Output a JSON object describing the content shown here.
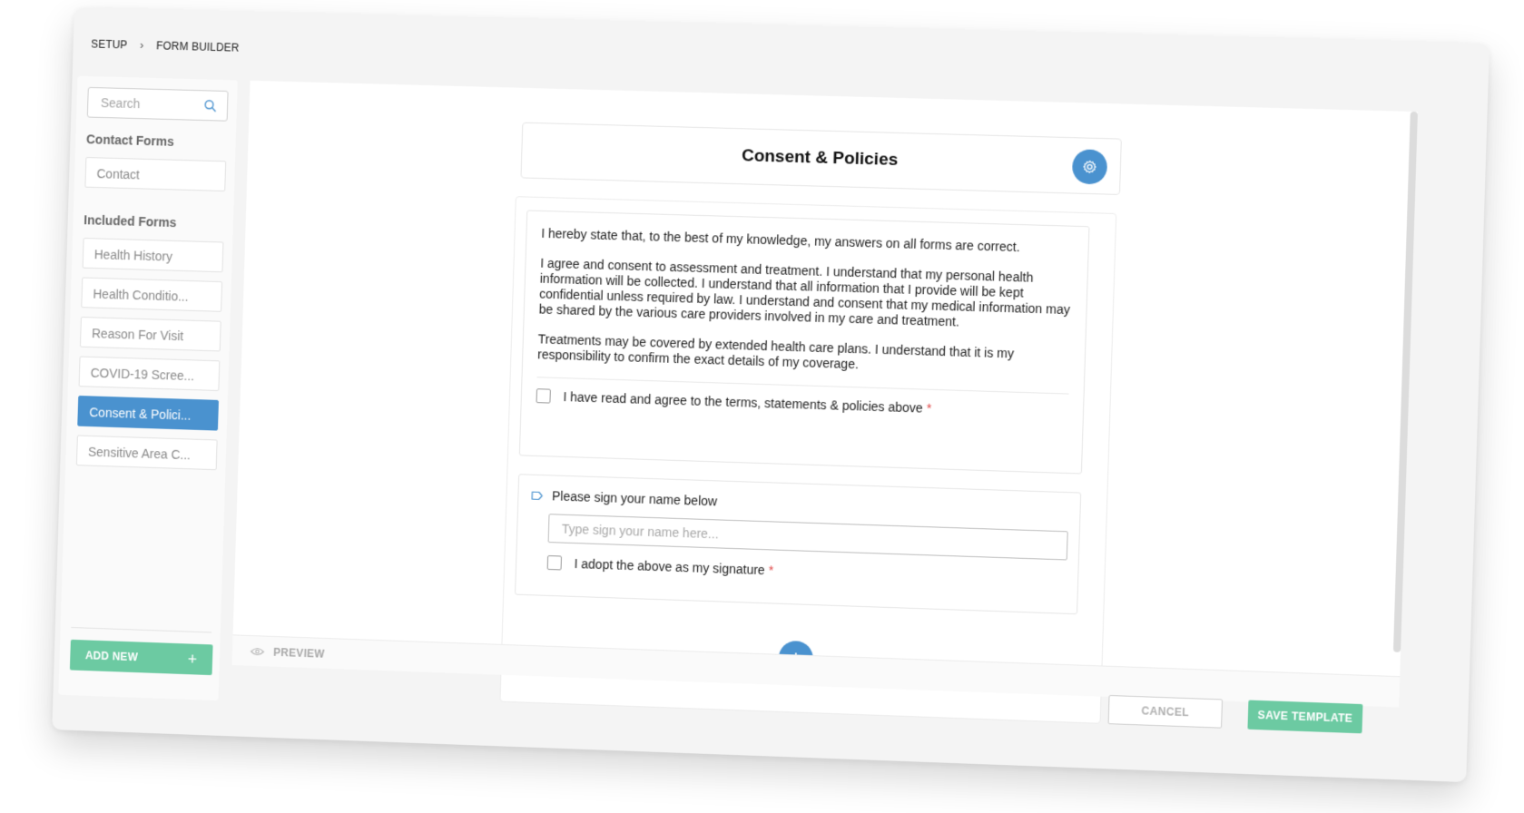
{
  "breadcrumb": {
    "items": [
      "SETUP",
      "FORM BUILDER"
    ]
  },
  "sidebar": {
    "search_placeholder": "Search",
    "contact_section_label": "Contact Forms",
    "contact_items": [
      "Contact"
    ],
    "included_section_label": "Included Forms",
    "included_items": [
      {
        "label": "Health History",
        "active": false
      },
      {
        "label": "Health Conditio...",
        "active": false
      },
      {
        "label": "Reason For Visit",
        "active": false
      },
      {
        "label": "COVID-19 Scree...",
        "active": false
      },
      {
        "label": "Consent & Polici...",
        "active": true
      },
      {
        "label": "Sensitive Area C...",
        "active": false
      }
    ],
    "add_new_label": "ADD NEW"
  },
  "form": {
    "title": "Consent & Policies",
    "paragraphs": [
      "I hereby state that, to the best of my knowledge, my answers on all forms are correct.",
      "I agree and consent to assessment and treatment. I understand that my personal health information will be collected. I understand that all information that I provide will be kept confidential unless required by law. I understand and consent that my medical information may be shared by the various care providers involved in my care and treatment.",
      "Treatments may be covered by extended health care plans. I understand that it is my responsibility to confirm the exact details of my coverage."
    ],
    "agree_label": "I have read and agree to the terms, statements & policies above",
    "required_mark": "*",
    "sign_label": "Please sign your name below",
    "sign_placeholder": "Type sign your name here...",
    "adopt_label": "I adopt the above as my signature",
    "add_block_glyph": "+"
  },
  "footer": {
    "preview_label": "PREVIEW",
    "cancel_label": "CANCEL",
    "save_label": "SAVE TEMPLATE"
  },
  "icons": {
    "search": "search-icon",
    "gear": "gear-icon",
    "tag": "tag-icon",
    "eye": "eye-icon",
    "plus": "plus-icon",
    "chevron": "chevron-right-icon"
  },
  "colors": {
    "accent_blue": "#4a92cf",
    "accent_green": "#6ccaa2",
    "required_red": "#e04a4a"
  }
}
